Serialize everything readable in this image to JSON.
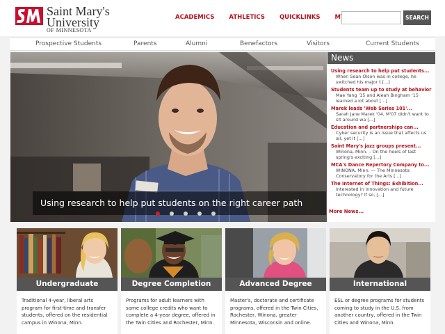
{
  "logo": {
    "line1": "Saint Mary's",
    "line2": "University",
    "line3": "OF MINNESOTA",
    "mark_color": "#c8102e"
  },
  "topnav": [
    {
      "label": "ACADEMICS"
    },
    {
      "label": "ATHLETICS"
    },
    {
      "label": "QUICKLINKS"
    },
    {
      "label": "MY SMU"
    }
  ],
  "search": {
    "value": "",
    "placeholder": "",
    "button_label": "SEARCH"
  },
  "audience_nav": [
    {
      "label": "Prospective Students"
    },
    {
      "label": "Parents"
    },
    {
      "label": "Alumni"
    },
    {
      "label": "Benefactors"
    },
    {
      "label": "Visitors"
    },
    {
      "label": "Current Students"
    }
  ],
  "hero": {
    "caption": "Using research to help put students on the right career path",
    "slide_count": 5,
    "active_slide": 1
  },
  "news": {
    "title": "News",
    "items": [
      {
        "headline": "Using research to help put students...",
        "summary": "When Sean Olson was in college, he switched his major t [...]"
      },
      {
        "headline": "Students team up to study at behavior",
        "summary": "Mae Yang '15 and Aleah Bingham '15 learned a lot about [...]"
      },
      {
        "headline": "Marek leads 'Web Series 101'...",
        "summary": "Sarah Jane Marek '04, M'07 didn't want to sit around wa [...]"
      },
      {
        "headline": "Education and partnerships can...",
        "summary": "Cyber security is an issue that affects us all, yet it [...]"
      },
      {
        "headline": "Saint Mary's jazz groups present...",
        "summary": "Winona, Minn. – On the heels of last spring's exciting [...]"
      },
      {
        "headline": "MCA's Dance Repertory Company to...",
        "summary": "WINONA, Minn. — The Minnesota Conservatory for the Arts [...]"
      },
      {
        "headline": "The Internet of Things: Exhibition...",
        "summary": "Interested in innovation and future technology? If so, [...]"
      }
    ],
    "more_label": "More News..."
  },
  "programs": [
    {
      "title": "Undergraduate",
      "text": "Traditional 4-year, liberal arts program for first-time and transfer students, offered on the residential campus in Winona, Minn."
    },
    {
      "title": "Degree Completion",
      "text": "Programs for adult learners with some college credits who want to complete a 4-year degree, offered in the Twin Cities and Rochester, Minn."
    },
    {
      "title": "Advanced Degree",
      "text": "Master's, doctorate and certificate programs, offered in the Twin Cities, Rochester, Winona, greater Minnesota, Wisconsin and online."
    },
    {
      "title": "International",
      "text": "ESL or degree programs for students coming to study in the U.S. from another country, offered in the Twin Cities and Winona, Minn."
    }
  ],
  "colors": {
    "accent": "#b5121b",
    "bar": "#555555",
    "background": "#f2f2f2"
  }
}
